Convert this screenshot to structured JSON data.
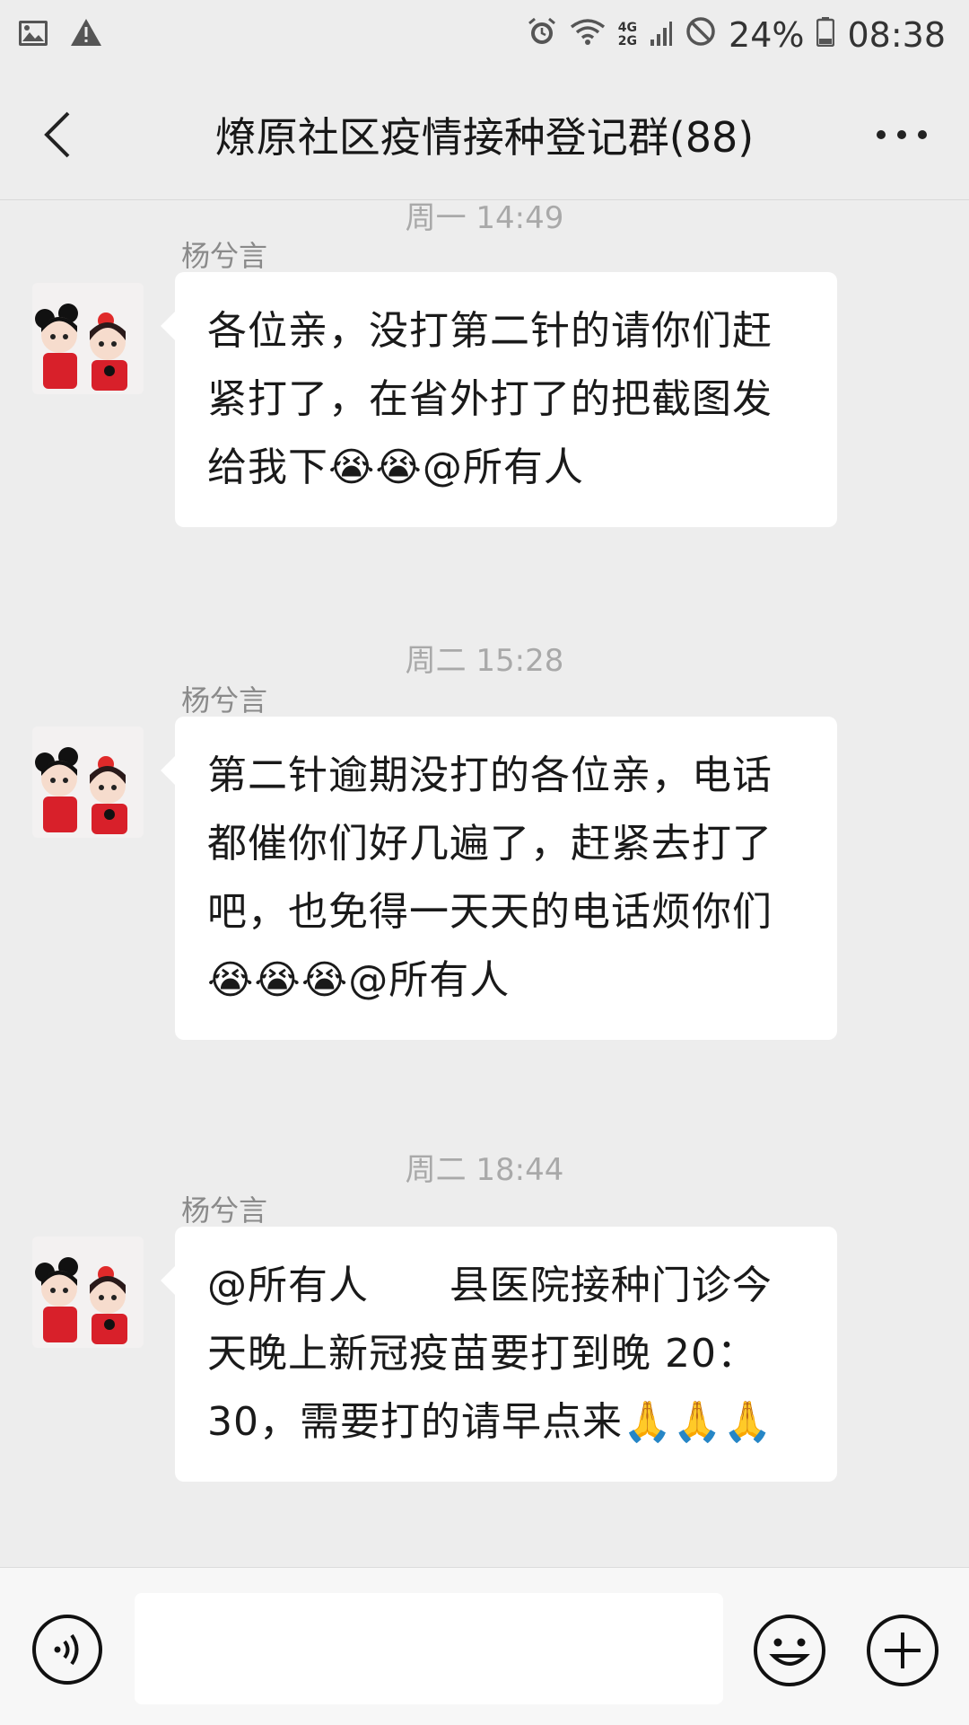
{
  "status_bar": {
    "icons_left": [
      "image-icon",
      "warning-icon"
    ],
    "icons_right": [
      "alarm-icon",
      "wifi-icon",
      "signal-icon",
      "do-not-disturb-icon",
      "battery-icon"
    ],
    "net_top": "4G",
    "net_bottom": "2G",
    "battery": "24%",
    "time": "08:38"
  },
  "header": {
    "title": "燎原社区疫情接种登记群(88)"
  },
  "messages": [
    {
      "time": "周一 14:49",
      "sender": "杨兮言",
      "text": "各位亲，没打第二针的请你们赶紧打了，在省外打了的把截图发给我下😭😭@所有人"
    },
    {
      "time": "周二 15:28",
      "sender": "杨兮言",
      "text": "第二针逾期没打的各位亲，电话都催你们好几遍了，赶紧去打了吧，也免得一天天的电话烦你们😭😭😭@所有人"
    },
    {
      "time": "周二 18:44",
      "sender": "杨兮言",
      "text": "@所有人      县医院接种门诊今天晚上新冠疫苗要打到晚 20：30，需要打的请早点来🙏🙏🙏"
    }
  ],
  "input_bar": {
    "placeholder": ""
  },
  "colors": {
    "background": "#ededed",
    "bubble": "#ffffff",
    "timestamp": "#a9a9a9",
    "sender": "#8a8a8a"
  }
}
